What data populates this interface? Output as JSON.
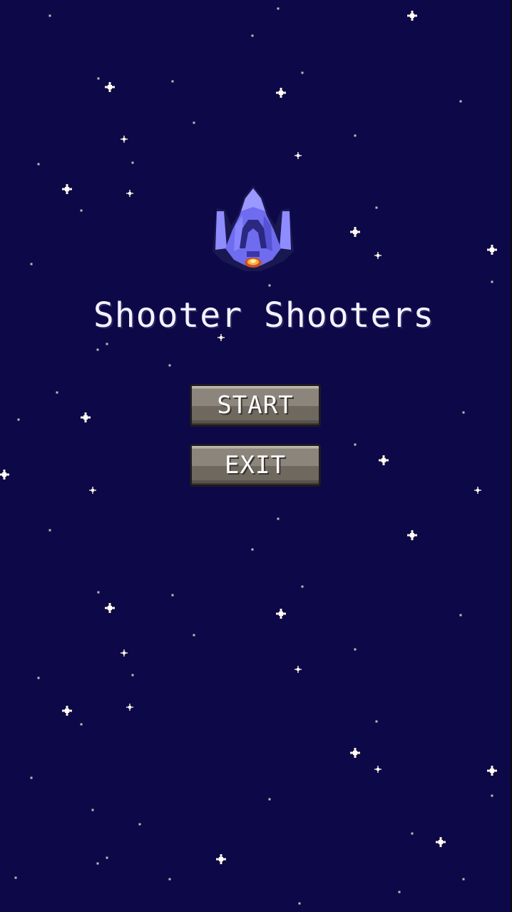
{
  "game": {
    "title": "Shooter Shooters"
  },
  "menu": {
    "start_label": "START",
    "exit_label": "EXIT"
  },
  "colors": {
    "background": "#0d0848",
    "star": "#fff3dc",
    "ship_primary": "#6f6cf0",
    "ship_outline": "#1a1850",
    "button_face": "#8c857c",
    "text": "#f4f2ff"
  },
  "icons": {
    "player_ship": "spaceship-icon",
    "background_star": "star-icon"
  }
}
